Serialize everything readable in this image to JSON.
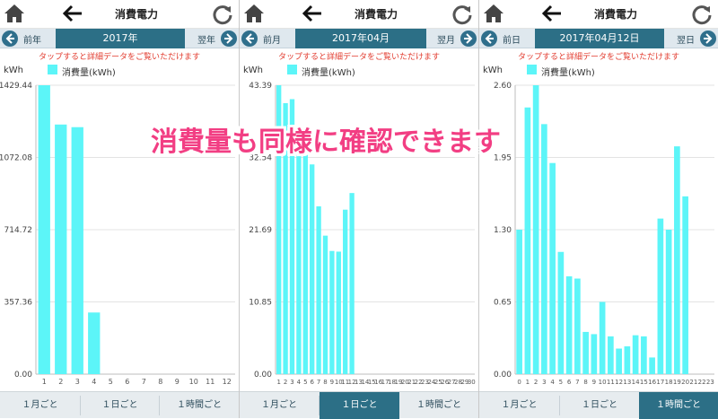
{
  "title": "消費電力",
  "hint": "タップすると詳細データをご覧いただけます",
  "unit": "kWh",
  "legend": "消費量(kWh)",
  "colors": {
    "bar": "#5cf5f8",
    "accent": "#2c6f86",
    "hint": "#e23b2e",
    "overlay": "#f23e83"
  },
  "tabs": [
    "１月ごと",
    "１日ごと",
    "１時間ごと"
  ],
  "overlay_text": "消費量も同様に確認できます",
  "screens": [
    {
      "nav": {
        "prev": "前年",
        "current": "2017年",
        "next": "翌年"
      },
      "active_tab": 0
    },
    {
      "nav": {
        "prev": "前月",
        "current": "2017年04月",
        "next": "翌月"
      },
      "active_tab": 1
    },
    {
      "nav": {
        "prev": "前日",
        "current": "2017年04月12日",
        "next": "翌日"
      },
      "active_tab": 2
    }
  ],
  "chart_data": [
    {
      "type": "bar",
      "ylabel": "kWh",
      "series": [
        {
          "name": "消費量(kWh)",
          "values": [
            1429.44,
            1235,
            1222,
            305,
            null,
            null,
            null,
            null,
            null,
            null,
            null,
            null
          ]
        }
      ],
      "categories": [
        "1",
        "2",
        "3",
        "4",
        "5",
        "6",
        "7",
        "8",
        "9",
        "10",
        "11",
        "12"
      ],
      "yticks": [
        "0.00",
        "357.36",
        "714.72",
        "1072.08",
        "1429.44"
      ],
      "ylim": [
        0,
        1429.44
      ]
    },
    {
      "type": "bar",
      "ylabel": "kWh",
      "series": [
        {
          "name": "消費量(kWh)",
          "values": [
            43.39,
            40.7,
            41.3,
            36.8,
            34.3,
            31.5,
            25.2,
            20.8,
            18.5,
            18.4,
            24.7,
            27.2,
            null,
            null,
            null,
            null,
            null,
            null,
            null,
            null,
            null,
            null,
            null,
            null,
            null,
            null,
            null,
            null,
            null,
            null
          ]
        }
      ],
      "categories": [
        "1",
        "2",
        "3",
        "4",
        "5",
        "6",
        "7",
        "8",
        "9",
        "10",
        "11",
        "12",
        "13",
        "14",
        "15",
        "16",
        "17",
        "18",
        "19",
        "20",
        "21",
        "22",
        "23",
        "24",
        "25",
        "26",
        "27",
        "28",
        "29",
        "30"
      ],
      "yticks": [
        "0.00",
        "10.85",
        "21.69",
        "32.54",
        "43.39"
      ],
      "ylim": [
        0,
        43.39
      ]
    },
    {
      "type": "bar",
      "ylabel": "kWh",
      "series": [
        {
          "name": "消費量(kWh)",
          "values": [
            1.3,
            2.4,
            2.6,
            2.25,
            1.9,
            1.1,
            0.88,
            0.86,
            0.38,
            0.36,
            0.65,
            0.34,
            0.23,
            0.25,
            0.35,
            0.34,
            0.15,
            1.4,
            1.3,
            2.05,
            1.6,
            null,
            null,
            null
          ]
        }
      ],
      "categories": [
        "0",
        "1",
        "2",
        "3",
        "4",
        "5",
        "6",
        "7",
        "8",
        "9",
        "10",
        "11",
        "12",
        "13",
        "14",
        "15",
        "16",
        "17",
        "18",
        "19",
        "20",
        "21",
        "22",
        "23"
      ],
      "yticks": [
        "0.00",
        "0.65",
        "1.30",
        "1.95",
        "2.60"
      ],
      "ylim": [
        0,
        2.6
      ]
    }
  ]
}
